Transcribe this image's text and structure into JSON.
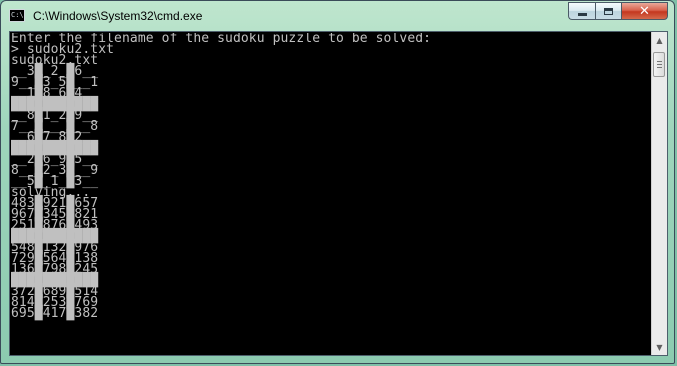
{
  "window": {
    "title": "C:\\Windows\\System32\\cmd.exe",
    "icon_name": "cmd-icon",
    "icon_text": "C:\\"
  },
  "caption": {
    "minimize_icon": "minimize-icon",
    "maximize_icon": "maximize-icon",
    "close_icon": "close-icon",
    "close_glyph": "✕"
  },
  "console": {
    "foreground": "#c0c0c0",
    "background": "#000000",
    "lines": [
      "Enter the filename of the sudoku puzzle to be solved:",
      "> sudoku2.txt",
      "sudoku2.txt",
      "__3█_2_█6__",
      "9__█3_5█__1",
      "__1█8_6█4__",
      "███████████",
      "__8█1_2█9__",
      "7__█___█__8",
      "__6█7_8█2__",
      "███████████",
      "__2█6_9█5__",
      "8__█2_3█__9",
      "__5█_1_█3__",
      "solving...",
      "483█921█657",
      "967█345█821",
      "251█876█493",
      "███████████",
      "548█132█976",
      "729█564█138",
      "136█798█245",
      "███████████",
      "372█689█514",
      "814█253█769",
      "695█417█382"
    ]
  },
  "scrollbar": {
    "up_glyph": "▲",
    "down_glyph": "▼"
  }
}
